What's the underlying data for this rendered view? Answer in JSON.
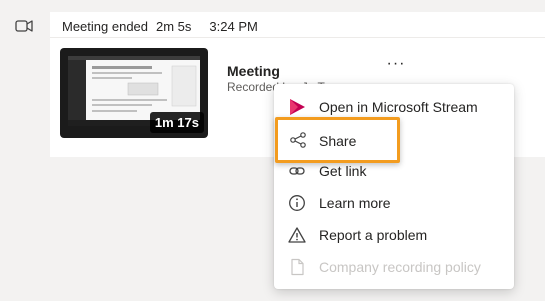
{
  "meeting": {
    "status": "Meeting ended",
    "duration_ended": "2m 5s",
    "time": "3:24 PM",
    "title": "Meeting",
    "subtitle": "Recorded by: Jo T..."
  },
  "recording": {
    "duration": "1m 17s"
  },
  "more_options_label": "···",
  "menu": {
    "items": [
      {
        "label": "Open in Microsoft Stream",
        "icon": "stream-icon"
      },
      {
        "label": "Share",
        "icon": "share-icon"
      },
      {
        "label": "Get link",
        "icon": "link-icon"
      },
      {
        "label": "Learn more",
        "icon": "info-icon"
      },
      {
        "label": "Report a problem",
        "icon": "warning-icon"
      },
      {
        "label": "Company recording policy",
        "icon": "document-icon",
        "disabled": true
      }
    ]
  },
  "colors": {
    "highlight": "#f39c1f",
    "stream_brand": "#c30052"
  }
}
